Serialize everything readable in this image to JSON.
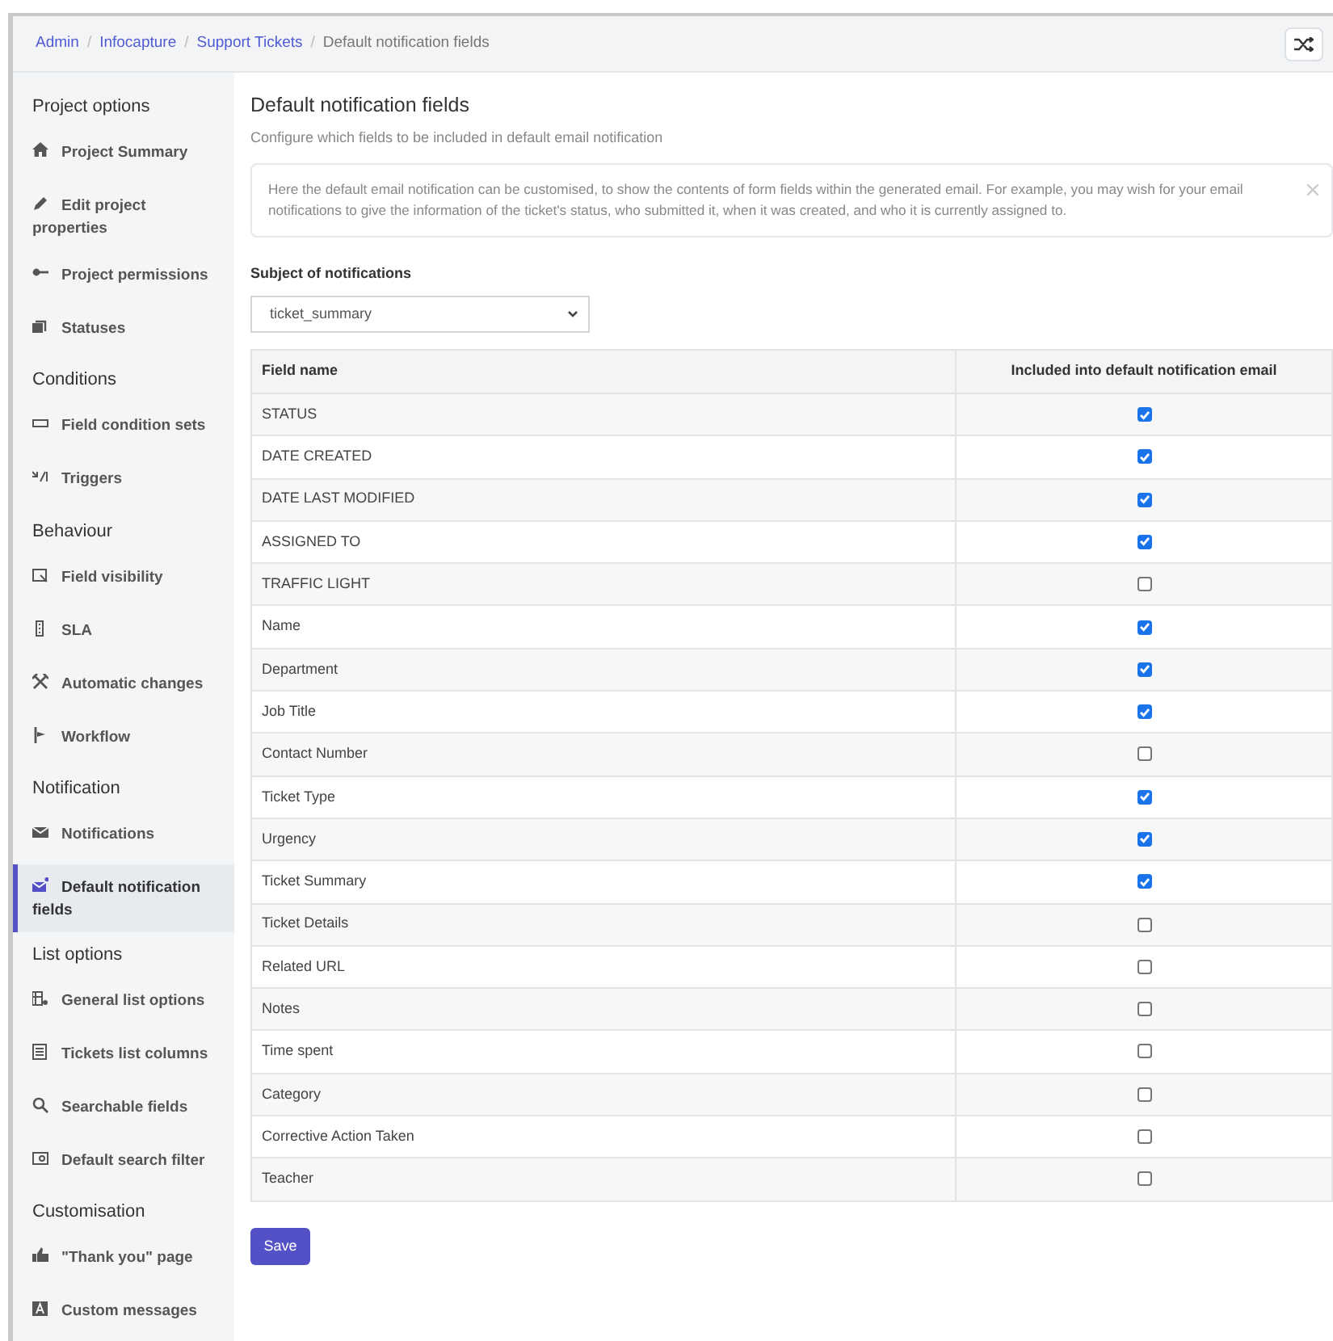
{
  "breadcrumb": [
    {
      "label": "Admin",
      "link": true
    },
    {
      "separator": "/",
      "label": "Infocapture",
      "link": true
    },
    {
      "separator": "/",
      "label": "Support Tickets",
      "link": true
    },
    {
      "separator": "/",
      "label": "Default notification fields",
      "link": false
    }
  ],
  "sidebar": {
    "items": [
      {
        "kind": "heading",
        "label": "Project options"
      },
      {
        "kind": "item",
        "label": "Project Summary",
        "selected": false
      },
      {
        "kind": "item",
        "label": "Edit project properties",
        "selected": false
      },
      {
        "kind": "item",
        "label": "Project permissions",
        "selected": false
      },
      {
        "kind": "item",
        "label": "Statuses",
        "selected": false
      },
      {
        "kind": "heading",
        "label": "Conditions"
      },
      {
        "kind": "item",
        "label": "Field condition sets",
        "selected": false
      },
      {
        "kind": "item",
        "label": "Triggers",
        "selected": false
      },
      {
        "kind": "heading",
        "label": "Behaviour"
      },
      {
        "kind": "item",
        "label": "Field visibility",
        "selected": false
      },
      {
        "kind": "item",
        "label": "SLA",
        "selected": false
      },
      {
        "kind": "item",
        "label": "Automatic changes",
        "selected": false
      },
      {
        "kind": "item",
        "label": "Workflow",
        "selected": false
      },
      {
        "kind": "heading",
        "label": "Notification"
      },
      {
        "kind": "item",
        "label": "Notifications",
        "selected": false
      },
      {
        "kind": "item",
        "label": "Default notification fields",
        "selected": true
      },
      {
        "kind": "heading",
        "label": "List options"
      },
      {
        "kind": "item",
        "label": "General list options",
        "selected": false
      },
      {
        "kind": "item",
        "label": "Tickets list columns",
        "selected": false
      },
      {
        "kind": "item",
        "label": "Searchable fields",
        "selected": false
      },
      {
        "kind": "item",
        "label": "Default search filter",
        "selected": false
      },
      {
        "kind": "heading",
        "label": "Customisation"
      },
      {
        "kind": "item",
        "label": "\"Thank you\" page",
        "selected": false
      },
      {
        "kind": "item",
        "label": "Custom messages",
        "selected": false
      }
    ]
  },
  "page": {
    "title": "Default notification fields",
    "subtitle": "Configure which fields to be included in default email notification",
    "info": "Here the default email notification can be customised, to show the contents of form fields within the generated email. For example, you may wish for your email notifications to give the information of the ticket's status, who submitted it, when it was created, and who it is currently assigned to.",
    "subject_label": "Subject of notifications",
    "subject_value": "ticket_summary",
    "table": {
      "columns": [
        "Field name",
        "Included into default notification email"
      ],
      "rows": [
        {
          "name": "STATUS",
          "checked": true
        },
        {
          "name": "DATE CREATED",
          "checked": true
        },
        {
          "name": "DATE LAST MODIFIED",
          "checked": true
        },
        {
          "name": "ASSIGNED TO",
          "checked": true
        },
        {
          "name": "TRAFFIC LIGHT",
          "checked": false
        },
        {
          "name": "Name",
          "checked": true
        },
        {
          "name": "Department",
          "checked": true
        },
        {
          "name": "Job Title",
          "checked": true
        },
        {
          "name": "Contact Number",
          "checked": false
        },
        {
          "name": "Ticket Type",
          "checked": true
        },
        {
          "name": "Urgency",
          "checked": true
        },
        {
          "name": "Ticket Summary",
          "checked": true
        },
        {
          "name": "Ticket Details",
          "checked": false
        },
        {
          "name": "Related URL",
          "checked": false
        },
        {
          "name": "Notes",
          "checked": false
        },
        {
          "name": "Time spent",
          "checked": false
        },
        {
          "name": "Category",
          "checked": false
        },
        {
          "name": "Corrective Action Taken",
          "checked": false
        },
        {
          "name": "Teacher",
          "checked": false
        }
      ]
    },
    "save": "Save"
  }
}
